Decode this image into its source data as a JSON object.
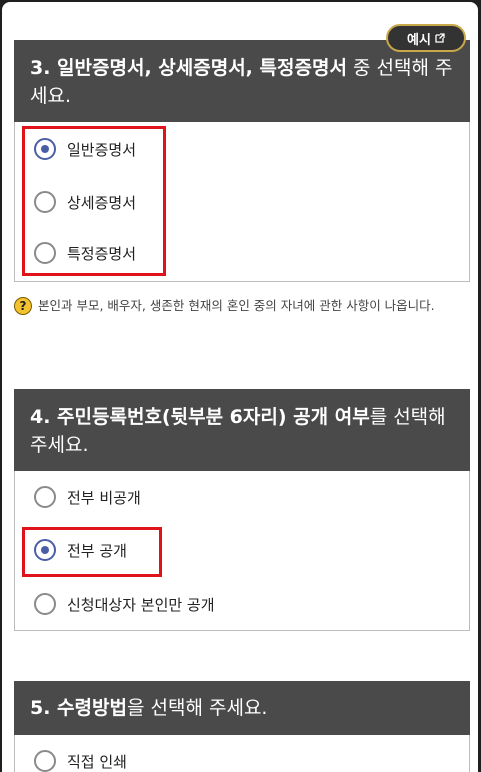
{
  "example_button": {
    "label": "예시",
    "icon": "external-link-icon"
  },
  "section3": {
    "title_bold": "3. 일반증명서, 상세증명서, 특정증명서",
    "title_rest": " 중 선택해 주세요.",
    "options": [
      {
        "label": "일반증명서",
        "checked": true
      },
      {
        "label": "상세증명서",
        "checked": false
      },
      {
        "label": "특정증명서",
        "checked": false
      }
    ],
    "help_text": "본인과 부모, 배우자, 생존한 현재의 혼인 중의 자녀에 관한 사항이 나옵니다."
  },
  "section4": {
    "title_bold1": "4. 주민등록번호(뒷부분 6자리) 공개 여부",
    "title_rest": "를 선택해 주세요.",
    "options": [
      {
        "label": "전부 비공개",
        "checked": false
      },
      {
        "label": "전부 공개",
        "checked": true
      },
      {
        "label": "신청대상자 본인만 공개",
        "checked": false
      }
    ]
  },
  "section5": {
    "title_bold": "5. 수령방법",
    "title_rest": "을 선택해 주세요.",
    "options": [
      {
        "label": "직접 인쇄",
        "checked": false
      }
    ]
  },
  "colors": {
    "header_bg": "#4a4a4a",
    "radio_selected": "#4a5ea8",
    "highlight_red": "#e0121a",
    "button_border": "#c9a84a",
    "help_icon": "#f2c230"
  }
}
